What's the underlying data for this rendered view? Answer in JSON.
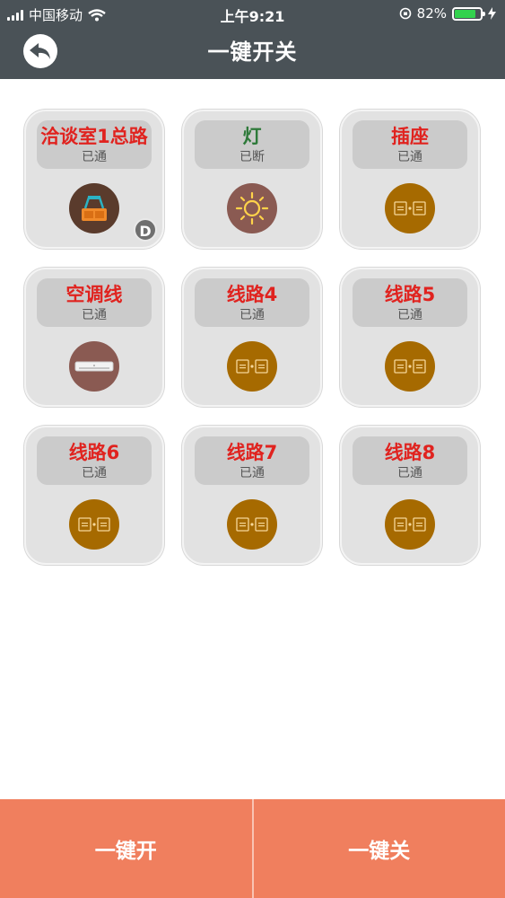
{
  "status_bar": {
    "carrier": "中国移动",
    "time": "上午9:21",
    "battery_pct": "82%",
    "battery_level": 0.82
  },
  "header": {
    "title": "一键开关",
    "back_icon": "back-arrow-icon"
  },
  "tiles": [
    {
      "name": "洽谈室1总路",
      "state": "已通",
      "name_color": "#e0231f",
      "icon": "projector-icon",
      "icon_bg": "#5a3b2c",
      "badge": "D"
    },
    {
      "name": "灯",
      "state": "已断",
      "name_color": "#2e7a3a",
      "icon": "light-bulb-icon",
      "icon_bg": "#8a5a52"
    },
    {
      "name": "插座",
      "state": "已通",
      "name_color": "#e0231f",
      "icon": "switch-icon",
      "icon_bg": "#a66a00"
    },
    {
      "name": "空调线",
      "state": "已通",
      "name_color": "#e0231f",
      "icon": "air-conditioner-icon",
      "icon_bg": "#8a5a52"
    },
    {
      "name": "线路4",
      "state": "已通",
      "name_color": "#e0231f",
      "icon": "switch-icon",
      "icon_bg": "#a66a00"
    },
    {
      "name": "线路5",
      "state": "已通",
      "name_color": "#e0231f",
      "icon": "switch-icon",
      "icon_bg": "#a66a00"
    },
    {
      "name": "线路6",
      "state": "已通",
      "name_color": "#e0231f",
      "icon": "switch-icon",
      "icon_bg": "#a66a00"
    },
    {
      "name": "线路7",
      "state": "已通",
      "name_color": "#e0231f",
      "icon": "switch-icon",
      "icon_bg": "#a66a00"
    },
    {
      "name": "线路8",
      "state": "已通",
      "name_color": "#e0231f",
      "icon": "switch-icon",
      "icon_bg": "#a66a00"
    }
  ],
  "footer": {
    "all_on_label": "一键开",
    "all_off_label": "一键关"
  },
  "colors": {
    "header_bg": "#4a5257",
    "footer_bg": "#f07f5e",
    "on_text": "#e0231f",
    "off_text": "#2e7a3a"
  }
}
